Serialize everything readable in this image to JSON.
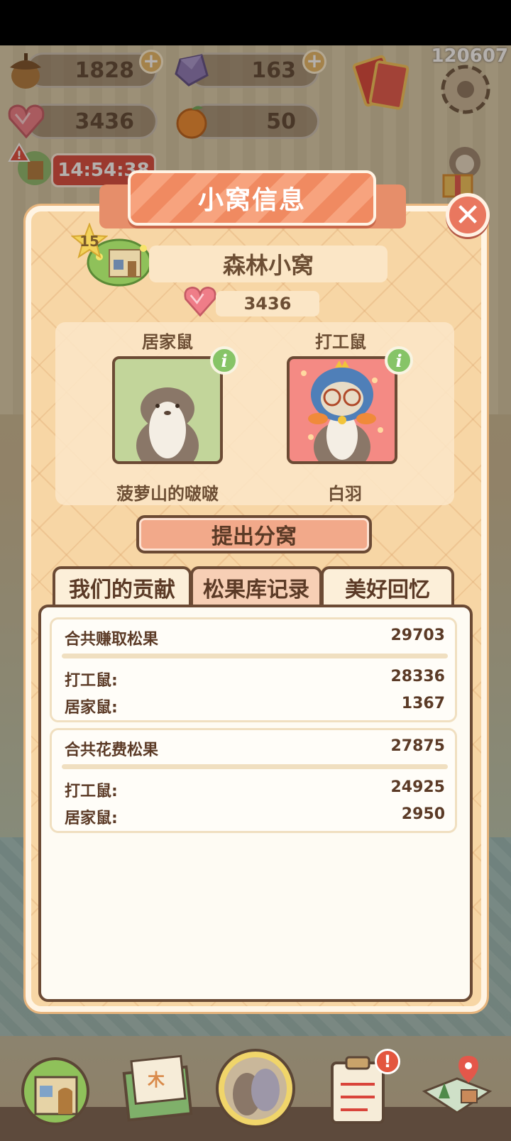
{
  "corner_id": "120607",
  "hud": {
    "acorns": "1828",
    "gems": "163",
    "hearts": "3436",
    "oranges": "50",
    "timer": "14:54:38"
  },
  "dialog": {
    "title": "小窝信息",
    "level": "15",
    "nest_name": "森林小窝",
    "heart_value": "3436",
    "roles": [
      {
        "role": "居家鼠",
        "name": "菠萝山的啵啵"
      },
      {
        "role": "打工鼠",
        "name": "白羽"
      }
    ],
    "split_button": "提出分窝",
    "tabs": [
      "我们的贡献",
      "松果库记录",
      "美好回忆"
    ],
    "active_tab": 1,
    "earned": {
      "title": "合共赚取松果",
      "total": "29703",
      "rows": [
        {
          "label": "打工鼠:",
          "value": "28336"
        },
        {
          "label": "居家鼠:",
          "value": "1367"
        }
      ]
    },
    "spent": {
      "title": "合共花费松果",
      "total": "27875",
      "rows": [
        {
          "label": "打工鼠:",
          "value": "24925"
        },
        {
          "label": "居家鼠:",
          "value": "2950"
        }
      ]
    }
  },
  "colors": {
    "accent_orange": "#f08a61",
    "panel": "#f7d6a5",
    "text_brown": "#5b3a26",
    "info_green": "#86c467",
    "close_red": "#e9775f"
  }
}
